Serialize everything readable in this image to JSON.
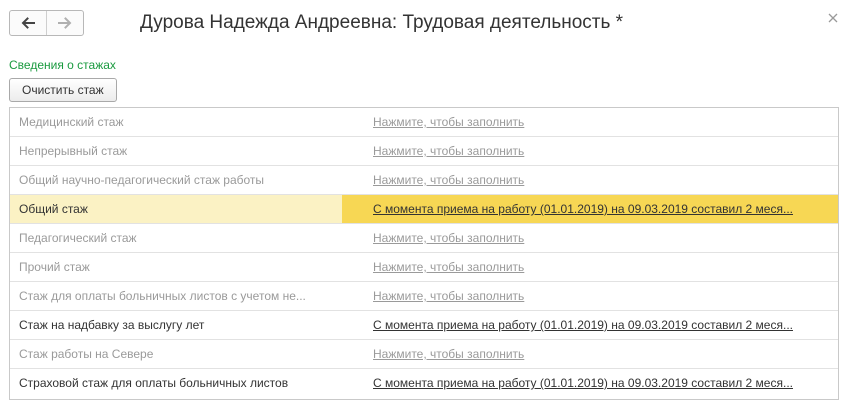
{
  "window": {
    "title": "Дурова Надежда Андреевна: Трудовая деятельность *"
  },
  "nav": {
    "back_icon": "arrow-left-icon",
    "forward_icon": "arrow-right-icon",
    "close_icon": "close-icon"
  },
  "section": {
    "title": "Сведения о стажах",
    "title_color": "#1a9a3f"
  },
  "toolbar": {
    "clear_label": "Очистить стаж"
  },
  "colors": {
    "selected_row": "#fbf2c4",
    "selected_cell": "#f7d754",
    "muted_text": "#9a9a9a"
  },
  "rows": [
    {
      "label": "Медицинский стаж",
      "value": "Нажмите, чтобы заполнить",
      "state": "empty",
      "selected": false
    },
    {
      "label": "Непрерывный стаж",
      "value": "Нажмите, чтобы заполнить",
      "state": "empty",
      "selected": false
    },
    {
      "label": "Общий научно-педагогический стаж работы",
      "value": "Нажмите, чтобы заполнить",
      "state": "empty",
      "selected": false
    },
    {
      "label": "Общий стаж",
      "value": "С момента приема на работу (01.01.2019) на 09.03.2019 составил 2 меся...",
      "state": "filled",
      "selected": true
    },
    {
      "label": "Педагогический стаж",
      "value": "Нажмите, чтобы заполнить",
      "state": "empty",
      "selected": false
    },
    {
      "label": "Прочий стаж",
      "value": "Нажмите, чтобы заполнить",
      "state": "empty",
      "selected": false
    },
    {
      "label": "Стаж для оплаты больничных листов с учетом не...",
      "value": "Нажмите, чтобы заполнить",
      "state": "empty",
      "selected": false
    },
    {
      "label": "Стаж на надбавку за выслугу лет",
      "value": "С момента приема на работу (01.01.2019) на 09.03.2019 составил 2 меся...",
      "state": "filled",
      "selected": false
    },
    {
      "label": "Стаж работы на Севере",
      "value": "Нажмите, чтобы заполнить",
      "state": "empty",
      "selected": false
    },
    {
      "label": "Страховой стаж для оплаты больничных листов",
      "value": "С момента приема на работу (01.01.2019) на 09.03.2019 составил 2 меся...",
      "state": "filled",
      "selected": false
    }
  ]
}
